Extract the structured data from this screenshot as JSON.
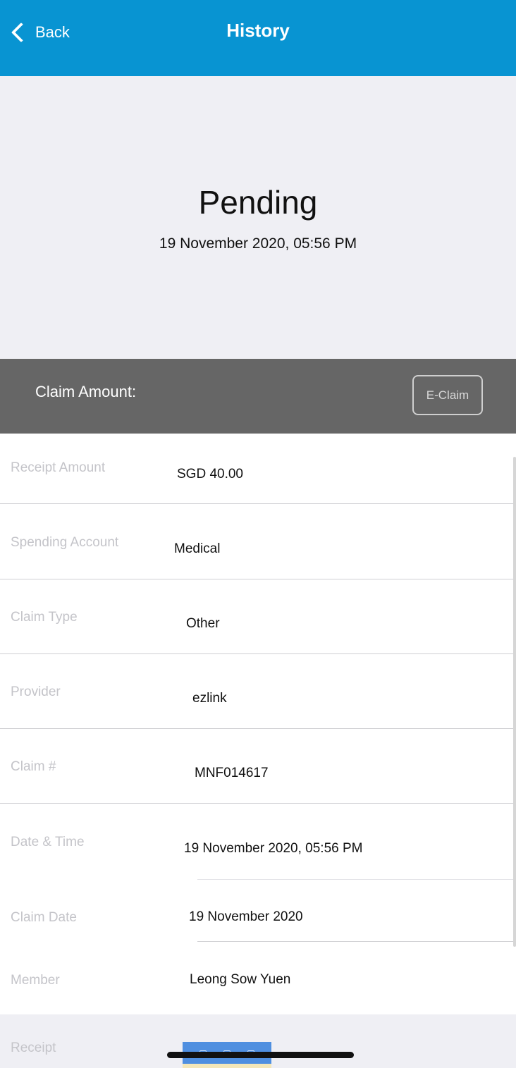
{
  "navbar": {
    "back_label": "Back",
    "title": "History",
    "background": "#0894d2"
  },
  "status": {
    "title": "Pending",
    "timestamp": "19 November 2020, 05:56 PM"
  },
  "amount_bar": {
    "label": "Claim Amount:",
    "button_label": "E-Claim"
  },
  "details": [
    {
      "label": "Receipt Amount",
      "value": "SGD 40.00"
    },
    {
      "label": "Spending Account",
      "value": "Medical"
    },
    {
      "label": "Claim Type",
      "value": "Other"
    },
    {
      "label": "Provider",
      "value": "ezlink"
    },
    {
      "label": "Claim #",
      "value": "MNF014617"
    },
    {
      "label": "Date & Time",
      "value": "19 November 2020, 05:56 PM"
    },
    {
      "label": "Claim Date",
      "value": "19 November 2020"
    },
    {
      "label": "Member",
      "value": "Leong Sow Yuen"
    }
  ],
  "receipt": {
    "label": "Receipt",
    "thumbnail_icon": "receipt-image-thumbnail"
  },
  "icons": {
    "back": "chevron-left-icon"
  }
}
